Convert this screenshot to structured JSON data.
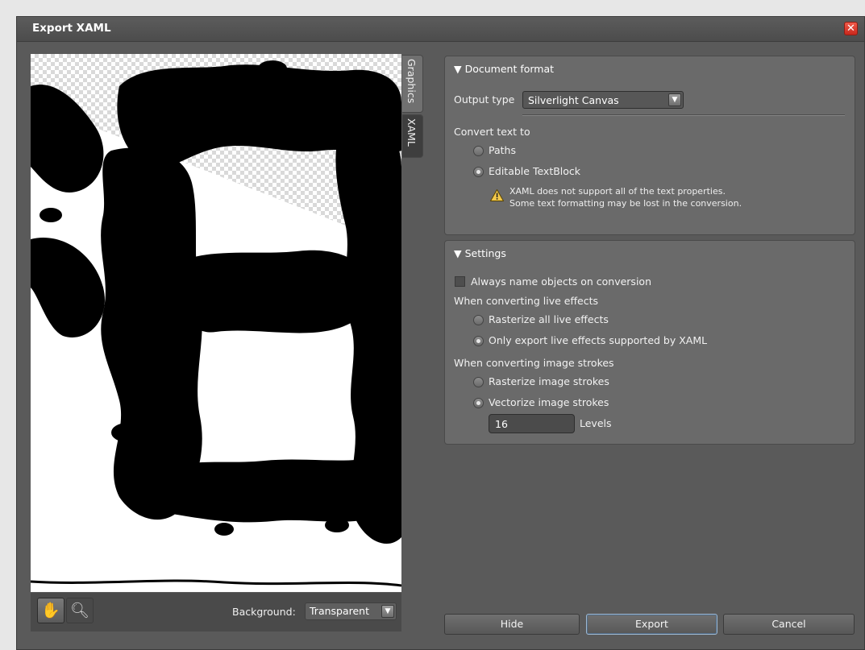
{
  "window": {
    "title": "Export XAML",
    "close_icon": "close-icon"
  },
  "side_tabs": {
    "graphics": "Graphics",
    "xaml": "XAML"
  },
  "preview_tools": {
    "hand_icon": "hand-icon",
    "zoom_icon": "magnifier-icon",
    "background_label": "Background:",
    "background_value": "Transparent"
  },
  "document_format": {
    "title": "▼ Document format",
    "output_type_label": "Output type",
    "output_type_value": "Silverlight Canvas",
    "convert_text_label": "Convert text to",
    "option_paths": "Paths",
    "option_textblock": "Editable TextBlock",
    "selected_option": "Editable TextBlock",
    "warning_line1": "XAML does not support all of the text properties.",
    "warning_line2": "Some text formatting may be lost in the conversion."
  },
  "settings": {
    "title": "▼ Settings",
    "always_name_label": "Always name objects on conversion",
    "always_name_checked": false,
    "live_effects_label": "When converting live effects",
    "option_rasterize_effects": "Rasterize all live effects",
    "option_export_effects": "Only export live effects supported by XAML",
    "image_strokes_label": "When converting image strokes",
    "option_rasterize_strokes": "Rasterize image strokes",
    "option_vectorize_strokes": "Vectorize image strokes",
    "levels_value": "16",
    "levels_label": "Levels"
  },
  "buttons": {
    "hide": "Hide",
    "export": "Export",
    "cancel": "Cancel"
  },
  "colors": {
    "dialog_bg": "#5a5a5a",
    "panel_bg": "#6a6a6a",
    "close_red": "#d8372b"
  }
}
